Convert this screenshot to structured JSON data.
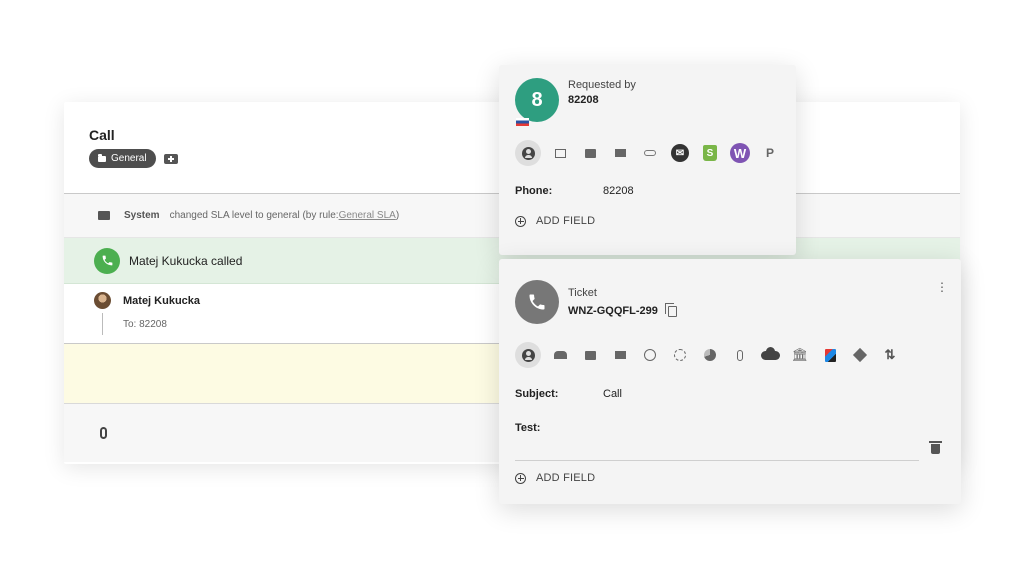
{
  "call": {
    "title": "Call",
    "tag_label": "General",
    "system_name": "System",
    "system_text": "changed SLA level to general (by rule: ",
    "system_link": "General SLA",
    "system_suffix": ")",
    "called_text": "Matej Kukucka called",
    "message_author": "Matej Kukucka",
    "message_to": "To: 82208"
  },
  "requester": {
    "badge": "8",
    "label": "Requested by",
    "value": "82208",
    "icons": [
      "contact-icon",
      "window-icon",
      "ticket-icon",
      "mail-icon",
      "link-icon",
      "mailchimp-icon",
      "shopify-icon",
      "woocommerce-icon",
      "pipedrive-icon"
    ],
    "woo_letter": "W",
    "shopify_letter": "S",
    "pipedrive_letter": "P",
    "fields": [
      {
        "label": "Phone:",
        "value": "82208"
      }
    ],
    "add_field": "ADD FIELD"
  },
  "ticket": {
    "label": "Ticket",
    "value": "WNZ-GQQFL-299",
    "icons": [
      "contact-icon",
      "people-icon",
      "ticket-icon",
      "mail-icon",
      "alarm-icon",
      "history-icon",
      "pie-icon",
      "attachment-icon",
      "cloud-icon",
      "bank-icon",
      "book-icon",
      "diamond-icon",
      "sync-icon"
    ],
    "fields": [
      {
        "label": "Subject:",
        "value": "Call"
      },
      {
        "label": "Test:",
        "value": ""
      }
    ],
    "add_field": "ADD FIELD"
  },
  "colors": {
    "requester_badge": "#2e9e80",
    "call_success": "#4caf50",
    "called_bg": "#e5f2e6",
    "reply_bg": "#fdfbe3"
  }
}
